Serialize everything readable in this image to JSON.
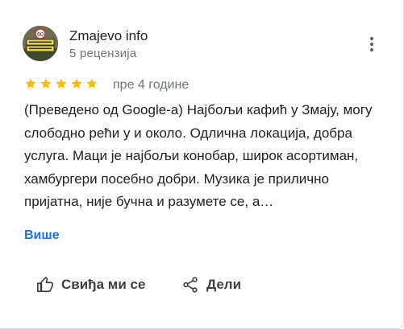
{
  "review": {
    "author": {
      "name": "Zmajevo info",
      "review_count": "5 рецензија",
      "avatar_icon": "town-sign-avatar"
    },
    "menu_icon": "more-vert-icon",
    "rating": 5,
    "rating_max": 5,
    "star_color": "#fbbc04",
    "date": "пре 4 године",
    "text": "(Преведено од Google-а) Најбољи кафић у Змају, могу слободно рећи у и около. Одлична локација, добра услуга. Маци је најбољи конобар, широк асортиман, хамбургери посебно добри. Музика је прилично пријатна, није бучна и разумете се, а…",
    "more_label": "Више",
    "more_color": "#1a73e8"
  },
  "actions": {
    "like_label": "Свиђа ми се",
    "like_icon": "thumb-up-icon",
    "share_label": "Дели",
    "share_icon": "share-icon"
  }
}
